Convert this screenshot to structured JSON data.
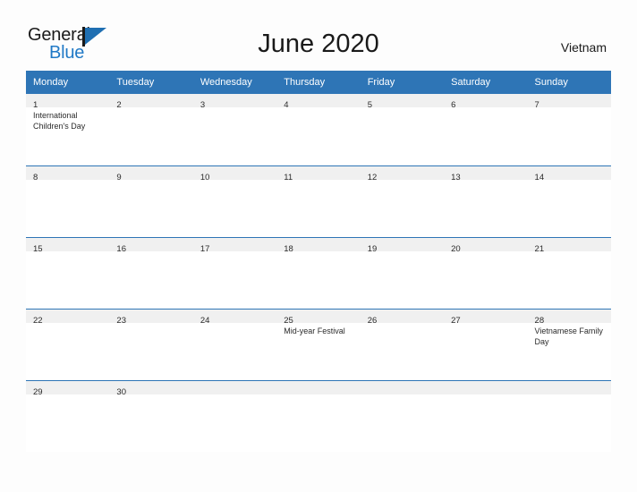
{
  "brand": {
    "word_one": "General",
    "word_two": "Blue",
    "flag_icon": "flag-triangle-icon"
  },
  "header": {
    "title": "June 2020",
    "location": "Vietnam"
  },
  "calendar": {
    "weekday_headers": [
      "Monday",
      "Tuesday",
      "Wednesday",
      "Thursday",
      "Friday",
      "Saturday",
      "Sunday"
    ],
    "accent_color": "#2e75b6",
    "band_color": "#f0f0f0",
    "weeks": [
      [
        {
          "day": "1",
          "events": [
            "International",
            "Children's Day"
          ]
        },
        {
          "day": "2",
          "events": []
        },
        {
          "day": "3",
          "events": []
        },
        {
          "day": "4",
          "events": []
        },
        {
          "day": "5",
          "events": []
        },
        {
          "day": "6",
          "events": []
        },
        {
          "day": "7",
          "events": []
        }
      ],
      [
        {
          "day": "8",
          "events": []
        },
        {
          "day": "9",
          "events": []
        },
        {
          "day": "10",
          "events": []
        },
        {
          "day": "11",
          "events": []
        },
        {
          "day": "12",
          "events": []
        },
        {
          "day": "13",
          "events": []
        },
        {
          "day": "14",
          "events": []
        }
      ],
      [
        {
          "day": "15",
          "events": []
        },
        {
          "day": "16",
          "events": []
        },
        {
          "day": "17",
          "events": []
        },
        {
          "day": "18",
          "events": []
        },
        {
          "day": "19",
          "events": []
        },
        {
          "day": "20",
          "events": []
        },
        {
          "day": "21",
          "events": []
        }
      ],
      [
        {
          "day": "22",
          "events": []
        },
        {
          "day": "23",
          "events": []
        },
        {
          "day": "24",
          "events": []
        },
        {
          "day": "25",
          "events": [
            "Mid-year Festival"
          ]
        },
        {
          "day": "26",
          "events": []
        },
        {
          "day": "27",
          "events": []
        },
        {
          "day": "28",
          "events": [
            "Vietnamese Family",
            "Day"
          ]
        }
      ],
      [
        {
          "day": "29",
          "events": []
        },
        {
          "day": "30",
          "events": []
        },
        {
          "day": "",
          "events": []
        },
        {
          "day": "",
          "events": []
        },
        {
          "day": "",
          "events": []
        },
        {
          "day": "",
          "events": []
        },
        {
          "day": "",
          "events": []
        }
      ]
    ]
  }
}
